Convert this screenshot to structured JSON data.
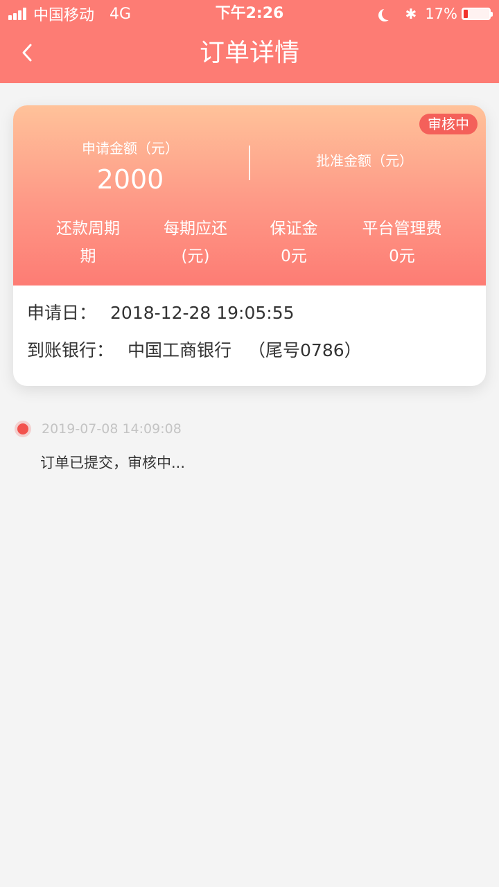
{
  "status_bar": {
    "carrier": "中国移动",
    "network": "4G",
    "time": "下午2:26",
    "battery_percent": "17%",
    "battery_level": 0.17
  },
  "header": {
    "title": "订单详情"
  },
  "card": {
    "status_badge": "审核中",
    "applied_amount": {
      "label": "申请金额（元）",
      "value": "2000"
    },
    "approved_amount": {
      "label": "批准金额（元）",
      "value": ""
    },
    "info": [
      {
        "label": "还款周期",
        "value": "期"
      },
      {
        "label": "每期应还",
        "value": "(元)"
      },
      {
        "label": "保证金",
        "value": "0元"
      },
      {
        "label": "平台管理费",
        "value": "0元"
      }
    ],
    "apply_date": {
      "label": "申请日：",
      "value": "2018-12-28 19:05:55"
    },
    "bank": {
      "label": "到账银行：",
      "value": "中国工商银行",
      "tail": "（尾号0786）"
    }
  },
  "timeline": [
    {
      "time": "2019-07-08 14:09:08",
      "text": "订单已提交，审核中..."
    }
  ],
  "colors": {
    "header_bg": "#fd7c74",
    "card_gradient_top": "#ffc29a",
    "card_gradient_bottom": "#fd7c74",
    "badge_bg": "#f4605a",
    "timeline_dot": "#f2524d",
    "page_bg": "#f4f4f4"
  },
  "icons": {
    "back": "chevron-left-icon",
    "signal": "signal-icon",
    "moon": "moon-icon",
    "bluetooth": "bluetooth-icon",
    "battery": "battery-icon"
  }
}
